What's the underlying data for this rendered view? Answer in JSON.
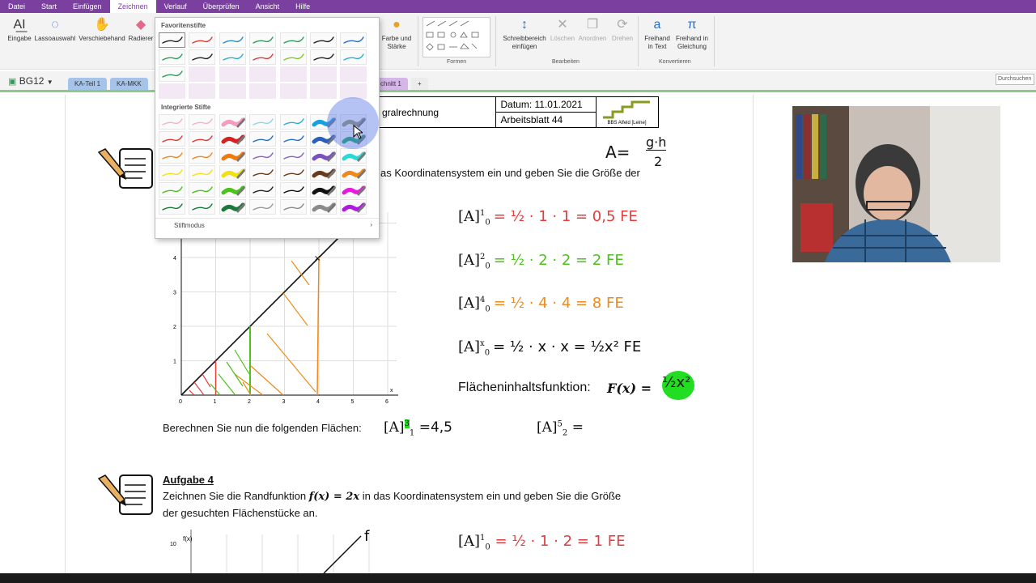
{
  "menu": [
    "Datei",
    "Start",
    "Einfügen",
    "Zeichnen",
    "Verlauf",
    "Überprüfen",
    "Ansicht",
    "Hilfe"
  ],
  "ribbon": {
    "eingabe": "Eingabe",
    "lasso": "Lassoauswahl",
    "verschiebehand": "Verschiebehand",
    "radierer": "Radierer",
    "farbe": "Farbe und Stärke",
    "formen_label": "Formen",
    "schreibbereich": "Schreibbereich einfügen",
    "loeschen": "Löschen",
    "anordnen": "Anordnen",
    "drehen": "Drehen",
    "bearbeiten_label": "Bearbeiten",
    "freihand_text": "Freihand in Text",
    "freihand_gleichung": "Freihand in Gleichung",
    "konvertieren_label": "Konvertieren"
  },
  "notebook": {
    "name": "BG12",
    "sections": [
      "KA-Teil 1",
      "KA-MKK"
    ],
    "partial_section": "chnitt 1",
    "add": "+",
    "search_placeholder": "Durchsuchen"
  },
  "pen_popup": {
    "favorites_title": "Favoritenstifte",
    "integrated_title": "Integrierte Stifte",
    "mode_label": "Stiftmodus",
    "favorites": [
      "#222222",
      "#e03b3b",
      "#2a8fc7",
      "#2e9e5b",
      "#2e9e5b",
      "#222222",
      "#2a6fc7",
      "#2e9e5b",
      "#222222",
      "#2ab0d0",
      "#e03b3b",
      "#7ccf2a",
      "#222222",
      "#2ab0d0",
      "#2e9e5b"
    ],
    "integrated": [
      [
        "#f5b3c9",
        "#f5b3c9",
        "#f29ec0",
        "#8fd7e8",
        "#2ab0d0",
        "#1aa0e0",
        "#9a9a68"
      ],
      [
        "#e03b3b",
        "#e03b3b",
        "#d92020",
        "#2a6fc7",
        "#2a6fc7",
        "#2a5fc0",
        "#1aa86a"
      ],
      [
        "#ef8a1a",
        "#ef8a1a",
        "#ef7a10",
        "#8a5fc7",
        "#8a5fc7",
        "#7a4fc0",
        "#2ad8d8"
      ],
      [
        "#f2e21a",
        "#f2e21a",
        "#f2e010",
        "#6b3a1a",
        "#6b3a1a",
        "#6b3a1a",
        "#ef8a1a"
      ],
      [
        "#4cc21c",
        "#4cc21c",
        "#4cc21c",
        "#222222",
        "#111111",
        "#111111",
        "#e81ae0"
      ],
      [
        "#1a7a3a",
        "#1a7a3a",
        "#1a7a3a",
        "#9a9a9a",
        "#8a8a8a",
        "#8a8a8a",
        "#b01ae0"
      ]
    ]
  },
  "worksheet": {
    "title": "gralrechnung",
    "date": "Datum: 11.01.2021",
    "sheet": "Arbeitsblatt 44",
    "logo": "BBS Alfeld [Leine]",
    "task_text_1": "as Koordinatensystem ein und geben Sie die Größe der",
    "area_formula_lhs": "A=",
    "area_formula_num": "g·h",
    "area_formula_den": "2",
    "results": [
      {
        "lhs": "[A]",
        "sup": "1",
        "sub": "0",
        "rhs": "= ½ · 1 · 1 = 0,5 FE",
        "color": "red"
      },
      {
        "lhs": "[A]",
        "sup": "2",
        "sub": "0",
        "rhs": "= ½ · 2 · 2 = 2 FE",
        "color": "green"
      },
      {
        "lhs": "[A]",
        "sup": "4",
        "sub": "0",
        "rhs": "= ½ · 4 · 4 = 8 FE",
        "color": "orange"
      },
      {
        "lhs": "[A]",
        "sup": "x",
        "sub": "0",
        "rhs": "= ½ · x · x = ½x² FE",
        "color": "black"
      }
    ],
    "flaechen_text": "Flächeninhaltsfunktion:",
    "flaechen_fx": "F(x) =",
    "flaechen_ans": "½x²",
    "berechnen": "Berechnen Sie nun die folgenden Flächen:",
    "calc1": "[A]",
    "calc1_sup": "3",
    "calc1_sub": "1",
    "calc1_rhs": "=4,5",
    "calc2": "[A]",
    "calc2_sup": "5",
    "calc2_sub": "2",
    "calc2_rhs": "=",
    "aufgabe4": "Aufgabe 4",
    "a4_line1_pre": "Zeichnen Sie die Randfunktion",
    "a4_fx": "f(x) = 2x",
    "a4_line1_post": "in das Koordinatensystem ein und geben Sie die Größe",
    "a4_line2": "der gesuchten Flächenstücke an.",
    "a4_result_rhs": "= ½ · 1 · 2 = 1 FE",
    "a4_result_sup": "1",
    "a4_result_sub": "0",
    "graph_f_label": "f",
    "graph2_ylabel": "f(x)",
    "graph2_tick10": "10",
    "graph_x_ticks": [
      "0",
      "1",
      "2",
      "3",
      "4",
      "5",
      "6"
    ],
    "graph_y_ticks": [
      "1",
      "2",
      "3",
      "4"
    ],
    "graph_x_label": "x"
  },
  "colors": {
    "menubar": "#7b3fa0",
    "accent_green": "#8fc98a",
    "tab_blue": "#a6c4ea",
    "tab_purple": "#d4b6e8"
  }
}
